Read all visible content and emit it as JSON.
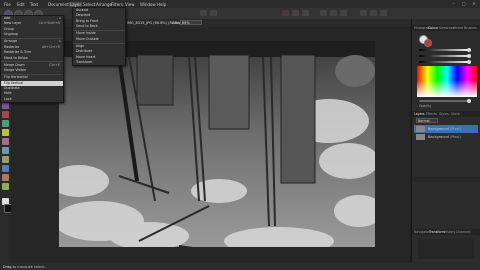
{
  "menubar": {
    "items": [
      "File",
      "Edit",
      "Text",
      "Document",
      "Layer",
      "Select",
      "Arrange",
      "Filters",
      "View",
      "Window",
      "Help"
    ],
    "window_controls": [
      "–",
      "▢",
      "✕"
    ]
  },
  "toolbar": {
    "document_title": "IMG_8315_JPG (66.6%) (RGBA/8)",
    "zoom_label": "Zoom",
    "zoom_value": "66%"
  },
  "layer_menu": {
    "items": [
      {
        "label": "Add"
      },
      {
        "label": "New Layer",
        "shortcut": "Ctrl+Shift+N"
      },
      {
        "label": "Group"
      },
      {
        "label": "Ungroup"
      },
      {
        "label": "Arrange"
      },
      {
        "label": "Rasterize",
        "shortcut": "Alt+Ctrl+R"
      },
      {
        "label": "Rasterize & Trim"
      },
      {
        "label": "Mask to Below"
      },
      {
        "label": "Merge Down",
        "shortcut": "Ctrl+E"
      },
      {
        "label": "Merge Visible"
      },
      {
        "label": "Flip Horizontal"
      },
      {
        "label": "Flip Vertical",
        "highlighted": true
      },
      {
        "label": "Duplicate"
      },
      {
        "label": "Hide"
      },
      {
        "label": "Lock"
      }
    ]
  },
  "arrange_submenu": {
    "items": [
      "Ascend",
      "Descend",
      "Bring to Front",
      "Send to Back",
      "Move Inside",
      "Move Outside",
      "Align",
      "Distribute",
      "Move Insert",
      "Transform"
    ]
  },
  "right_panel": {
    "top_tabs": [
      "Histogram",
      "Colour",
      "Swatches",
      "Stroke",
      "Brushes"
    ],
    "active_top_tab": "Colour",
    "opacity_label": "Opacity",
    "layer_tabs": [
      "Layers",
      "Effects",
      "Styles",
      "Stock"
    ],
    "active_layer_tab": "Layers",
    "blend_mode": "Normal",
    "layers": [
      {
        "name": "Background",
        "type": "(Pixel)",
        "selected": true
      },
      {
        "name": "Background",
        "type": "(Pixel)",
        "selected": false
      }
    ],
    "bottom_tabs": [
      "Navigator",
      "Transform",
      "History",
      "Channels"
    ],
    "active_bottom_tab": "Transform"
  },
  "statusbar": {
    "label": "Drag",
    "text": "to marquee select."
  }
}
